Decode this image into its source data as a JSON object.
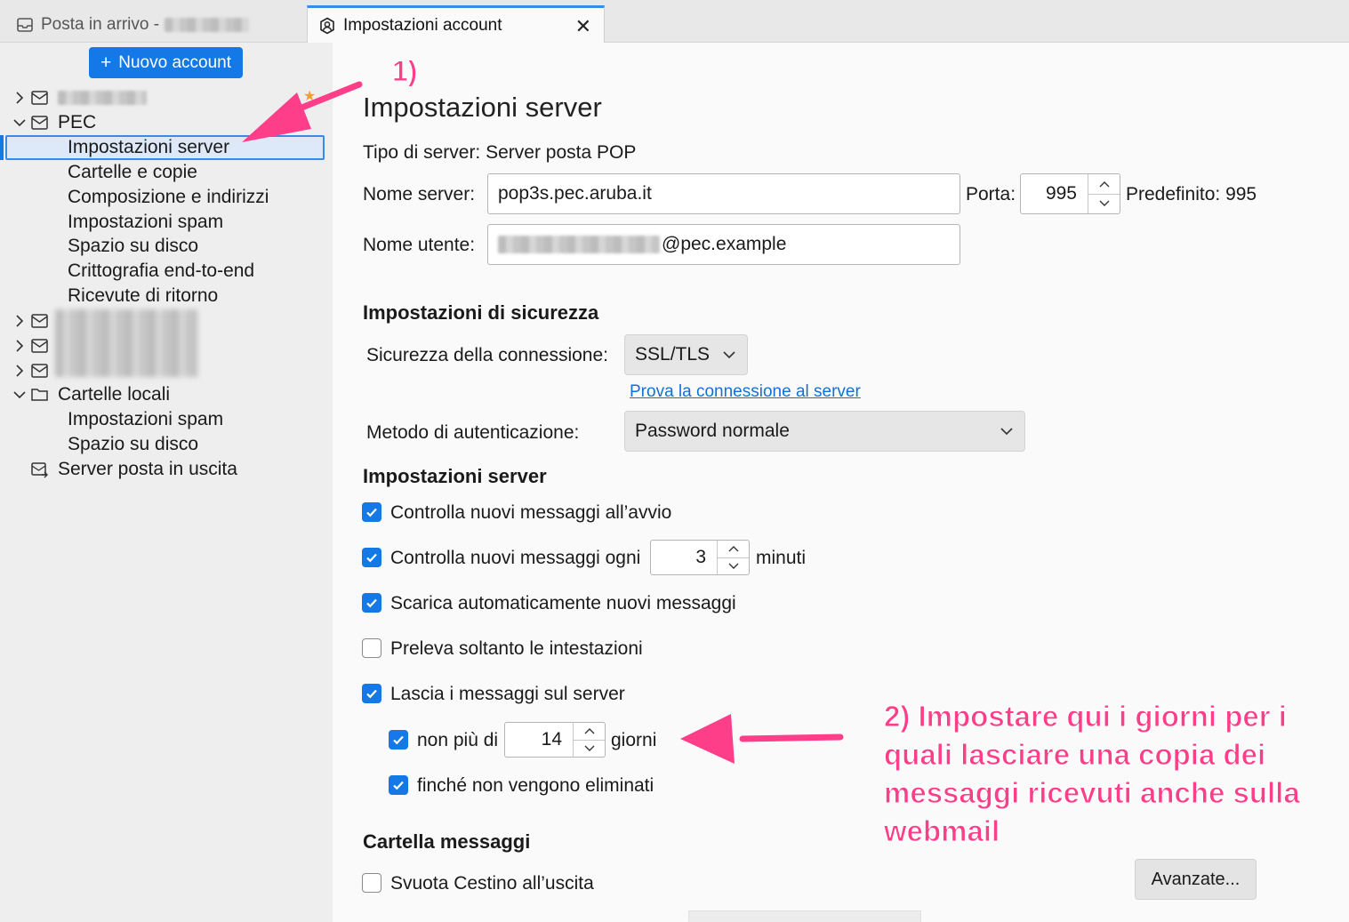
{
  "tabs": [
    {
      "label": "Posta in arrivo -",
      "active": false
    },
    {
      "label": "Impostazioni account",
      "active": true
    }
  ],
  "sidebar": {
    "new_account_label": "Nuovo account",
    "pec_account": {
      "label": "PEC",
      "items": [
        "Impostazioni server",
        "Cartelle e copie",
        "Composizione e indirizzi",
        "Impostazioni spam",
        "Spazio su disco",
        "Crittografia end-to-end",
        "Ricevute di ritorno"
      ]
    },
    "local_folders": {
      "label": "Cartelle locali",
      "items": [
        "Impostazioni spam",
        "Spazio su disco"
      ]
    },
    "outgoing_server_label": "Server posta in uscita"
  },
  "main": {
    "title": "Impostazioni server",
    "server_type": "Tipo di server: Server posta POP",
    "server_name_label": "Nome server:",
    "server_name_value": "pop3s.pec.aruba.it",
    "port_label": "Porta:",
    "port_value": "995",
    "default_port": "Predefinito: 995",
    "username_label": "Nome utente:",
    "username_suffix": "@pec.example",
    "security_section": "Impostazioni di sicurezza",
    "connection_security_label": "Sicurezza della connessione:",
    "connection_security_value": "SSL/TLS",
    "test_connection_link": "Prova la connessione al server",
    "auth_method_label": "Metodo di autenticazione:",
    "auth_method_value": "Password normale",
    "server_section": "Impostazioni server",
    "check_on_startup": {
      "label": "Controlla nuovi messaggi all’avvio",
      "checked": true
    },
    "check_every": {
      "label": "Controlla nuovi messaggi ogni",
      "value": "3",
      "unit": "minuti",
      "checked": true
    },
    "auto_download": {
      "label": "Scarica automaticamente nuovi messaggi",
      "checked": true
    },
    "headers_only": {
      "label": "Preleva soltanto le intestazioni",
      "checked": false
    },
    "leave_on_server": {
      "label": "Lascia i messaggi sul server",
      "checked": true
    },
    "max_days": {
      "label": "non più di",
      "value": "14",
      "unit": "giorni",
      "checked": true
    },
    "until_deleted": {
      "label": "finché non vengono eliminati",
      "checked": true
    },
    "folder_section": "Cartella messaggi",
    "empty_trash": {
      "label": "Svuota Cestino all’uscita",
      "checked": false
    },
    "advanced_button": "Avanzate..."
  },
  "annotations": {
    "step1": "1)",
    "step2": "2) Impostare qui i giorni per i quali lasciare una copia dei messaggi ricevuti anche sulla webmail"
  },
  "colors": {
    "accent": "#1478e6",
    "annotation": "#ff3e8a"
  }
}
